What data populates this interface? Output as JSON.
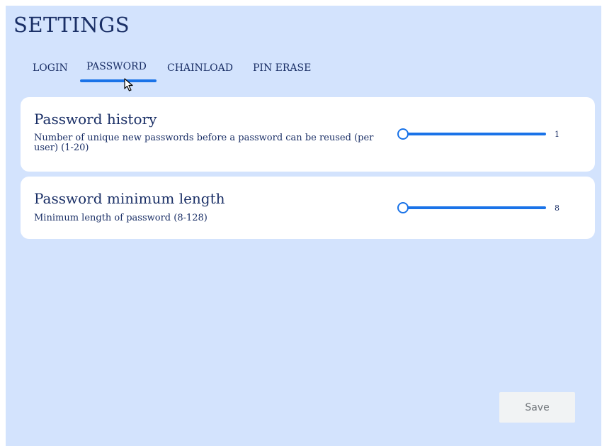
{
  "header": {
    "title": "SETTINGS"
  },
  "tabs": [
    {
      "label": "LOGIN",
      "active": false
    },
    {
      "label": "PASSWORD",
      "active": true
    },
    {
      "label": "CHAINLOAD",
      "active": false
    },
    {
      "label": "PIN ERASE",
      "active": false
    }
  ],
  "settings": [
    {
      "title": "Password history",
      "description": "Number of unique new passwords before a password can be reused (per user) (1-20)",
      "value": "1",
      "min": 1,
      "max": 20
    },
    {
      "title": "Password minimum length",
      "description": "Minimum length of password (8-128)",
      "value": "8",
      "min": 8,
      "max": 128
    }
  ],
  "actions": {
    "save_label": "Save"
  },
  "colors": {
    "background": "#d3e3fd",
    "accent": "#1a73e8",
    "text": "#1a2f66",
    "card": "#ffffff",
    "button_disabled_bg": "#f1f3f4",
    "button_disabled_text": "#70757a"
  },
  "icons": {
    "cursor": "mouse-pointer-icon"
  }
}
